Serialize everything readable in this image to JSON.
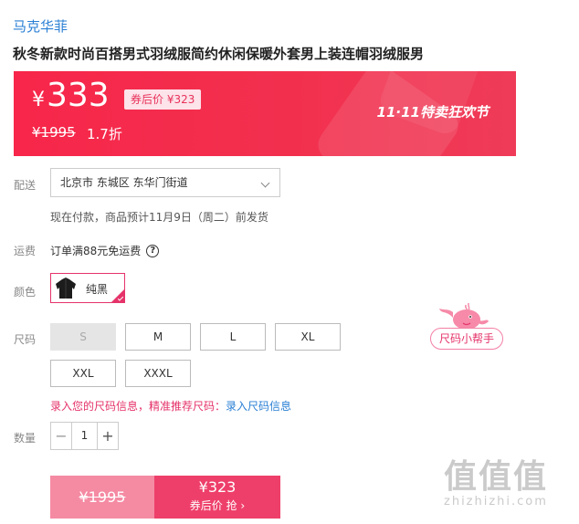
{
  "brand": "马克华菲",
  "title": "秋冬新款时尚百搭男式羽绒服简约休闲保暖外套男上装连帽羽绒服男",
  "banner": {
    "currency": "¥",
    "price": "333",
    "coupon_tag": "券后价 ¥323",
    "orig_price": "¥1995",
    "discount": "1.7折",
    "event": "11·11特卖狂欢节"
  },
  "delivery": {
    "label": "配送",
    "address": "北京市 东城区 东华门街道",
    "note": "现在付款，商品预计11月9日（周二）前发货"
  },
  "freight": {
    "label": "运费",
    "text": "订单满88元免运费",
    "help": "?"
  },
  "color": {
    "label": "颜色",
    "options": [
      {
        "name": "纯黑",
        "selected": true
      }
    ]
  },
  "size": {
    "label": "尺码",
    "options": [
      "S",
      "M",
      "L",
      "XL",
      "XXL",
      "XXXL"
    ],
    "disabled": [
      "S"
    ],
    "helper": "尺码小帮手",
    "info_prefix": "录入您的尺码信息，精准推荐尺码：",
    "info_link": "录入尺码信息"
  },
  "quantity": {
    "label": "数量",
    "value": "1",
    "minus": "−",
    "plus": "+"
  },
  "buy": {
    "orig_price": "¥1995",
    "coupon_price": "¥323",
    "action": "券后价 抢 ›"
  },
  "watermark": {
    "logo": "值值值",
    "url": "zhizhizhi.com"
  },
  "colors": {
    "accent": "#e5336a",
    "banner": "#f7264a",
    "link": "#2a7fd4"
  }
}
